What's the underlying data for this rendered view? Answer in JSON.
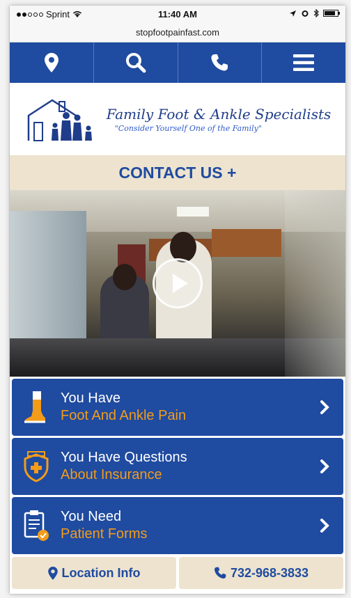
{
  "status_bar": {
    "carrier": "Sprint",
    "time": "11:40 AM",
    "url": "stopfootpainfast.com"
  },
  "nav": {
    "icons": [
      "location-pin-icon",
      "search-icon",
      "phone-icon",
      "hamburger-menu-icon"
    ]
  },
  "logo": {
    "title": "Family Foot & Ankle Specialists",
    "subtitle": "\"Consider Yourself One of the Family\""
  },
  "contact": {
    "label": "CONTACT US +"
  },
  "rows": [
    {
      "line1": "You Have",
      "line2": "Foot And Ankle Pain",
      "icon": "foot-icon"
    },
    {
      "line1": "You Have Questions",
      "line2": "About Insurance",
      "icon": "insurance-shield-icon"
    },
    {
      "line1": "You Need",
      "line2": "Patient Forms",
      "icon": "clipboard-check-icon"
    }
  ],
  "bottom": {
    "location_label": "Location Info",
    "phone_label": "732-968-3833"
  },
  "colors": {
    "primary": "#1f4ba0",
    "accent": "#f39c1a",
    "tan": "#ede3cf"
  }
}
